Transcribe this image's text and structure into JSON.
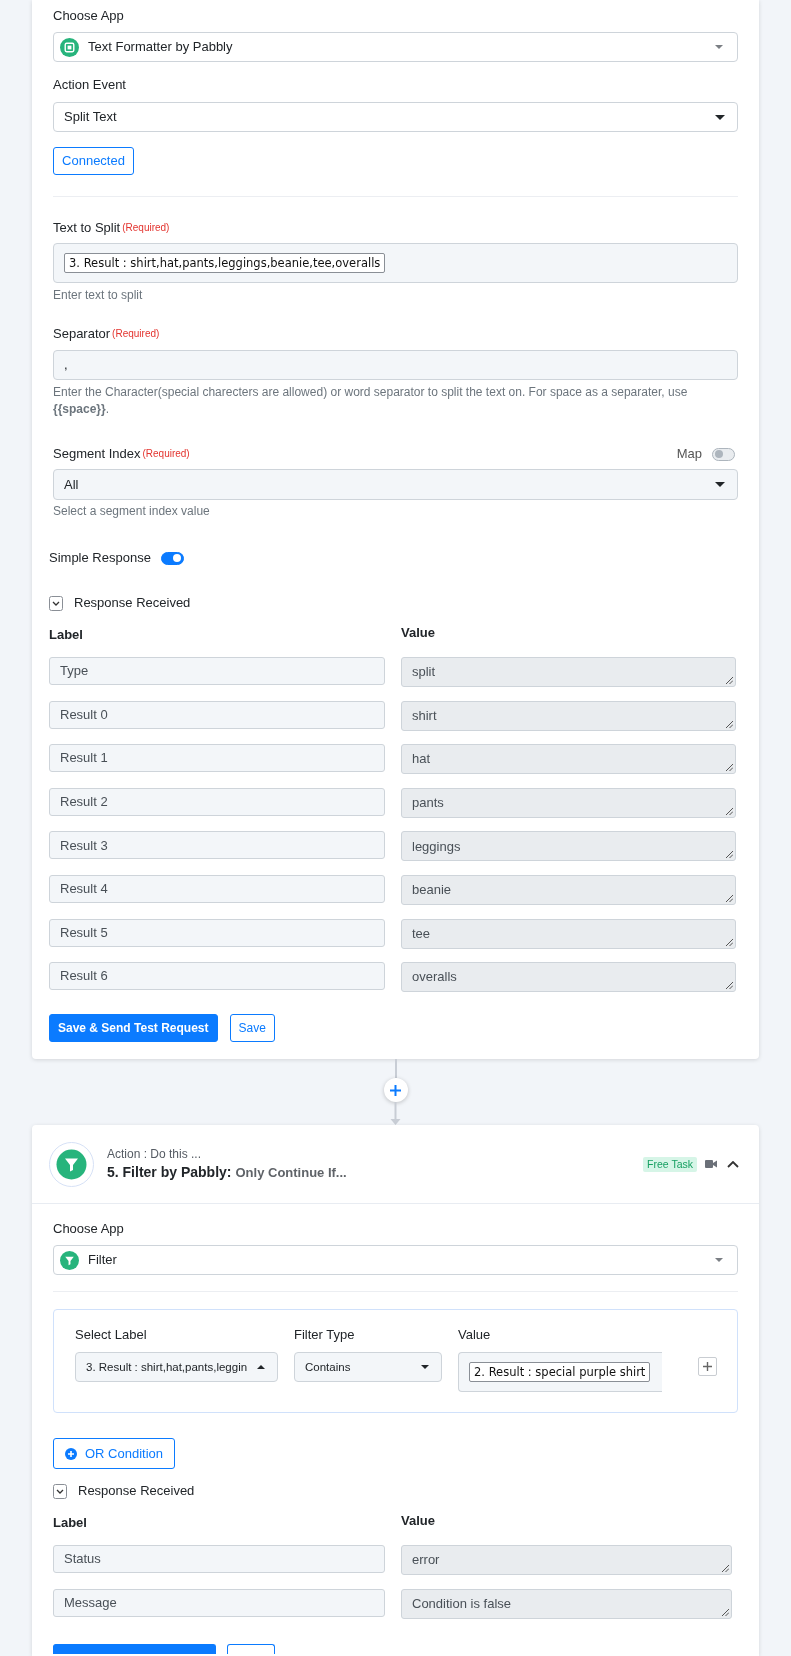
{
  "step_4": {
    "choose_app": {
      "label": "Choose App",
      "value": "Text Formatter by Pabbly"
    },
    "action_event": {
      "label": "Action Event",
      "value": "Split Text"
    },
    "connection_button": {
      "label": "Connected"
    },
    "fields": [
      {
        "kind": "token",
        "label": "Text to Split",
        "required": "(Required)",
        "token": "3. Result : shirt,hat,pants,leggings,beanie,tee,overalls",
        "help": "Enter text to split"
      },
      {
        "kind": "text",
        "label": "Separator",
        "required": "(Required)",
        "value": ",",
        "help": "Enter the Character(special charecters are allowed) or word separator to split the text on. For space as a separater, use **{{space}}**."
      },
      {
        "kind": "select",
        "label": "Segment Index",
        "required": "(Required)",
        "map": {
          "label": "Map",
          "on": false
        },
        "value": "All",
        "help": "Select a segment index value"
      }
    ],
    "simple_response": {
      "label": "Simple Response",
      "on": true
    },
    "response": {
      "title": "Response Received",
      "expanded": true,
      "label_heading": "Label",
      "value_heading": "Value",
      "rows": [
        {
          "label": "Type",
          "value": "split"
        },
        {
          "label": "Result 0",
          "value": "shirt"
        },
        {
          "label": "Result 1",
          "value": "hat"
        },
        {
          "label": "Result 2",
          "value": "pants"
        },
        {
          "label": "Result 3",
          "value": "leggings"
        },
        {
          "label": "Result 4",
          "value": "beanie"
        },
        {
          "label": "Result 5",
          "value": "tee"
        },
        {
          "label": "Result 6",
          "value": "overalls"
        }
      ]
    },
    "buttons": [
      {
        "kind": "primary",
        "label": "Save & Send Test Request"
      },
      {
        "kind": "secondary",
        "label": "Save"
      }
    ]
  },
  "step_5": {
    "subtitle": "Action : Do this ...",
    "title": "5. Filter by Pabbly:",
    "title_detail": "Only Continue If...",
    "badge": "Free Task",
    "expanded": true,
    "choose_app": {
      "label": "Choose App",
      "value": "Filter"
    },
    "filter": {
      "fields": [
        {
          "kind": "select",
          "heading": "Select Label",
          "value": "3. Result : shirt,hat,pants,leggin",
          "open": true
        },
        {
          "kind": "select",
          "heading": "Filter Type",
          "value": "Contains",
          "open": false
        },
        {
          "kind": "token",
          "heading": "Value",
          "token": "2. Result : special purple shirt"
        }
      ]
    },
    "or_button": {
      "label": "OR Condition"
    },
    "response": {
      "title": "Response Received",
      "expanded": true,
      "label_heading": "Label",
      "value_heading": "Value",
      "rows": [
        {
          "label": "Status",
          "value": "error"
        },
        {
          "label": "Message",
          "value": "Condition is false"
        }
      ]
    },
    "buttons": [
      {
        "kind": "primary"
      },
      {
        "kind": "secondary"
      }
    ]
  }
}
